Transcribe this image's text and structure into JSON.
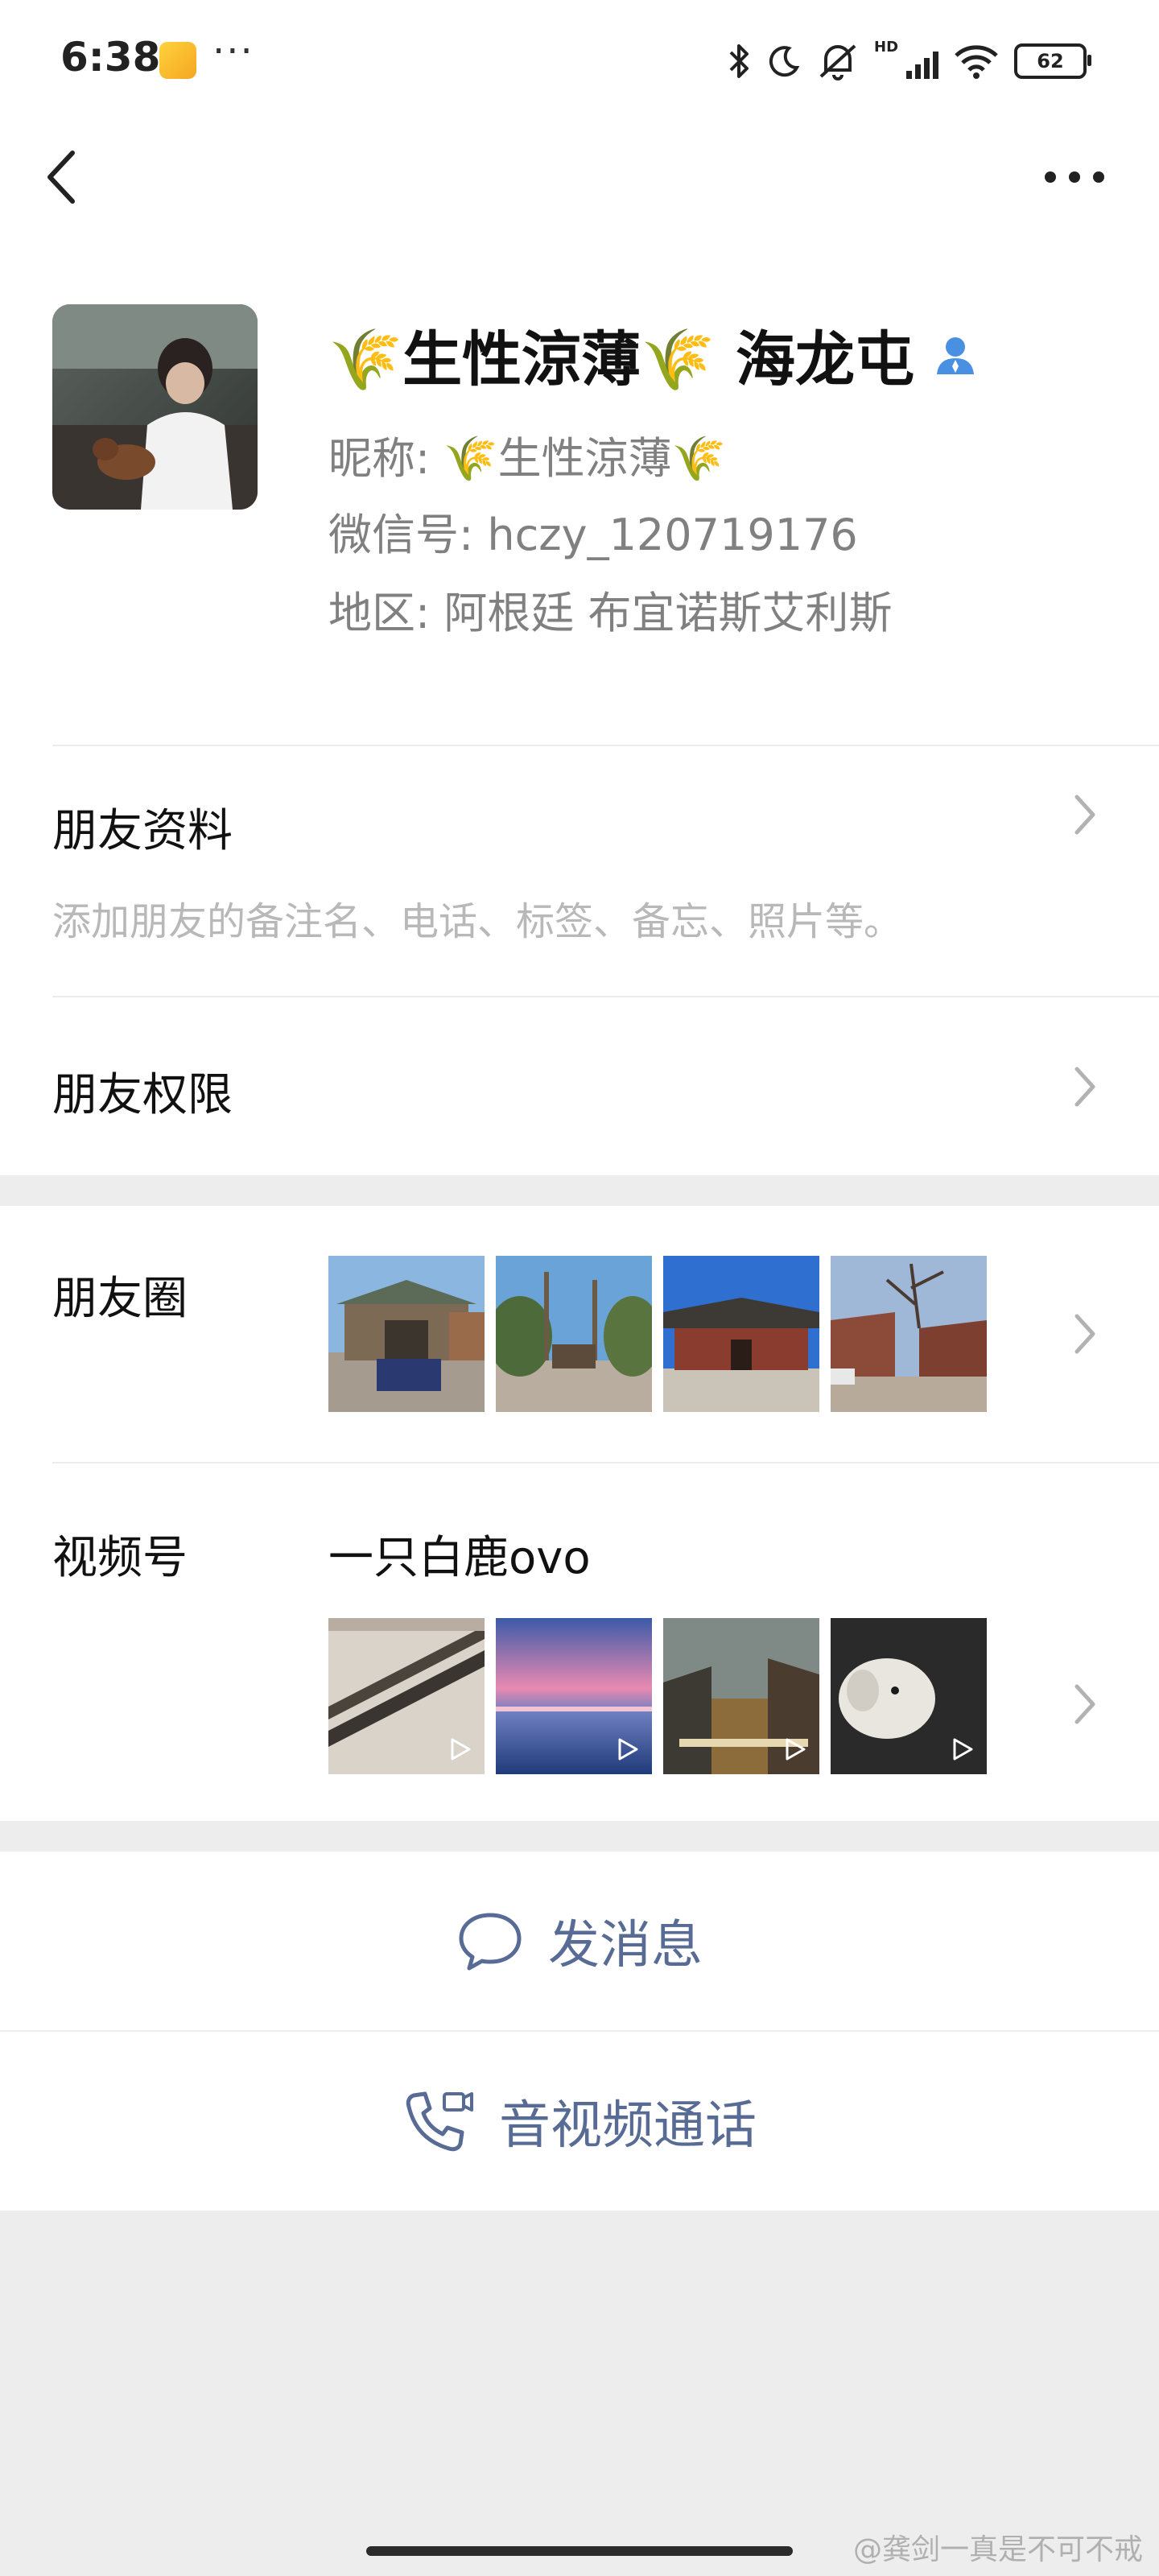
{
  "status_bar": {
    "time": "6:38",
    "notification_dots": "···",
    "network_label": "HD",
    "battery": "62"
  },
  "profile": {
    "display_name": "🌾生性涼薄🌾 海龙屯",
    "nickname_line": "昵称: 🌾生性涼薄🌾",
    "wechat_id_line": "微信号: hczy_120719176",
    "region_line": "地区: 阿根廷 布宜诺斯艾利斯"
  },
  "rows": {
    "friend_info": {
      "title": "朋友资料",
      "subtitle": "添加朋友的备注名、电话、标签、备忘、照片等。"
    },
    "friend_permissions": {
      "title": "朋友权限"
    },
    "moments": {
      "title": "朋友圈"
    },
    "channels": {
      "title": "视频号",
      "channel_name": "一只白鹿ovo"
    }
  },
  "actions": {
    "message": "发消息",
    "call": "音视频通话"
  },
  "watermark": "@龚剑一真是不可不戒",
  "colors": {
    "link_blue": "#576b95",
    "secondary_text": "#808080",
    "hint_text": "#b8b8b8",
    "page_background": "#ededed"
  },
  "icons": {
    "back": "chevron-left-icon",
    "more": "more-dots-icon",
    "contact_badge": "contact-icon",
    "row_arrow": "chevron-right-icon",
    "message": "chat-bubble-icon",
    "call": "phone-video-icon",
    "play": "play-icon"
  }
}
